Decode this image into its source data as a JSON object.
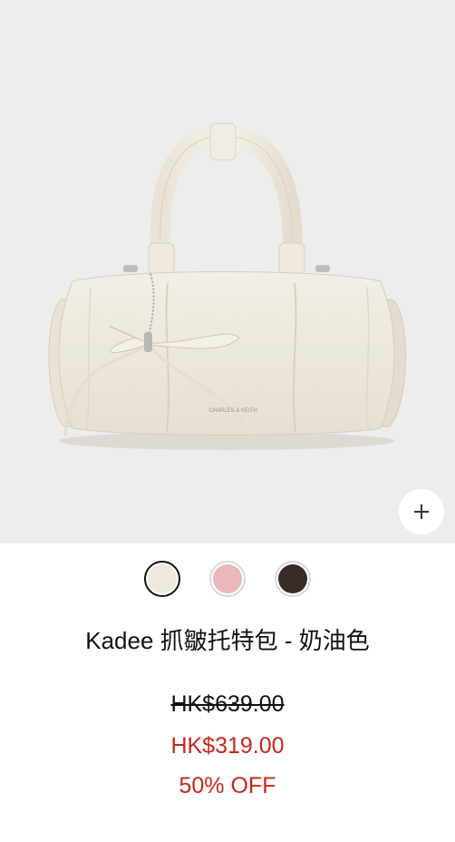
{
  "product": {
    "image_alt": "Kadee 抓皺托特包 - 奶油色",
    "brand_stamp": "CHARLES & KEITH",
    "title": "Kadee 抓皺托特包 - 奶油色",
    "original_price": "HK$639.00",
    "sale_price": "HK$319.00",
    "discount": "50% OFF"
  },
  "zoom_button": {
    "icon": "plus-icon"
  },
  "swatches": [
    {
      "name": "cream",
      "color": "#efe8dc",
      "selected": true
    },
    {
      "name": "pink",
      "color": "#e8b8bb",
      "selected": false
    },
    {
      "name": "dark-brown",
      "color": "#3a2b28",
      "selected": false
    }
  ],
  "colors": {
    "sale": "#c5281c",
    "image_background": "#ededed"
  }
}
